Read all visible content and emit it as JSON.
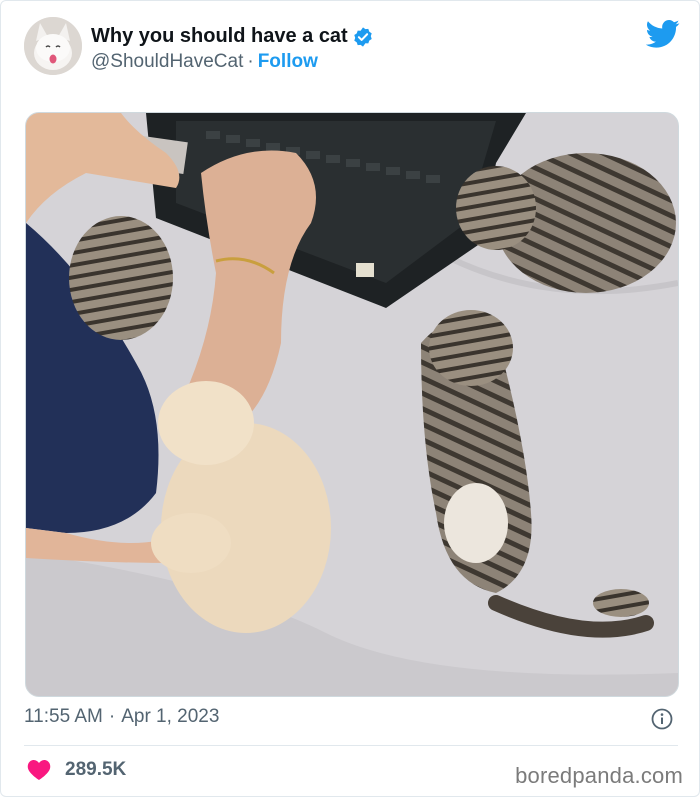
{
  "tweet": {
    "display_name": "Why you should have a cat",
    "handle": "@ShouldHaveCat",
    "separator": "·",
    "follow_label": "Follow",
    "time": "11:55 AM",
    "date": "Apr 1, 2023",
    "like_count": "289.5K"
  },
  "watermark": "boredpanda.com",
  "icons": {
    "avatar": "avatar-cat-photo",
    "verified": "verified-badge-icon",
    "brand": "twitter-bird-icon",
    "info": "info-icon",
    "like": "heart-icon"
  },
  "colors": {
    "accent": "#1d9bf0",
    "like": "#f91880",
    "muted": "#536471",
    "text": "#0f1419"
  }
}
